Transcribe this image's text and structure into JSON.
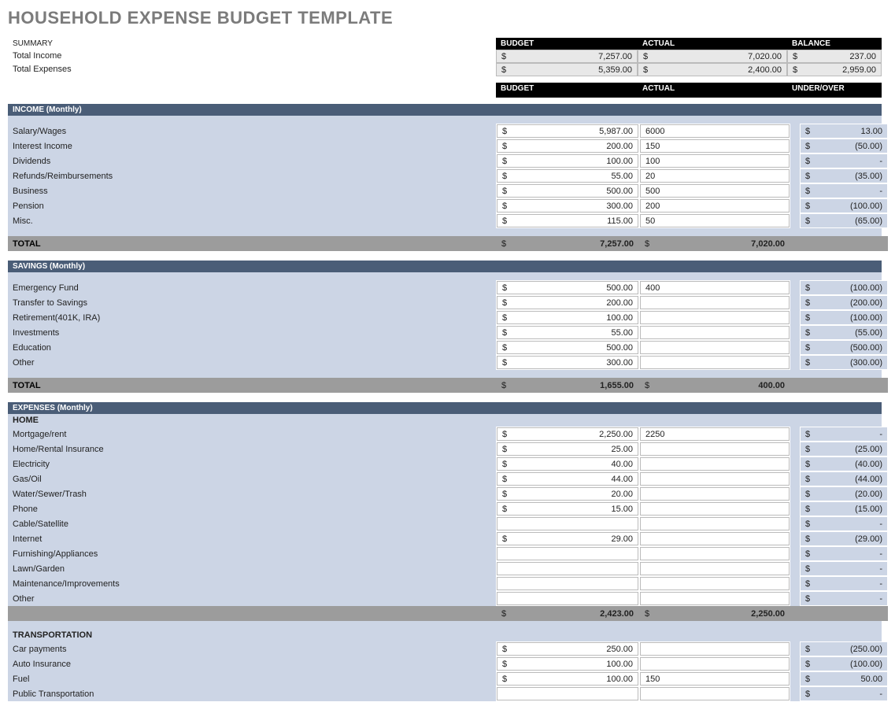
{
  "title": "HOUSEHOLD EXPENSE BUDGET TEMPLATE",
  "summary": {
    "label": "SUMMARY",
    "cols": {
      "budget": "BUDGET",
      "actual": "ACTUAL",
      "balance": "BALANCE"
    },
    "rows": [
      {
        "label": "Total Income",
        "budget": "7,257.00",
        "actual": "7,020.00",
        "balance": "237.00"
      },
      {
        "label": "Total Expenses",
        "budget": "5,359.00",
        "actual": "2,400.00",
        "balance": "2,959.00"
      }
    ]
  },
  "headers2": {
    "budget": "BUDGET",
    "actual": "ACTUAL",
    "uo": "UNDER/OVER"
  },
  "income": {
    "title": "INCOME (Monthly)",
    "rows": [
      {
        "label": "Salary/Wages",
        "budget": "5,987.00",
        "actual": "6000",
        "uo": "13.00"
      },
      {
        "label": "Interest Income",
        "budget": "200.00",
        "actual": "150",
        "uo": "(50.00)"
      },
      {
        "label": "Dividends",
        "budget": "100.00",
        "actual": "100",
        "uo": "-"
      },
      {
        "label": "Refunds/Reimbursements",
        "budget": "55.00",
        "actual": "20",
        "uo": "(35.00)"
      },
      {
        "label": "Business",
        "budget": "500.00",
        "actual": "500",
        "uo": "-"
      },
      {
        "label": "Pension",
        "budget": "300.00",
        "actual": "200",
        "uo": "(100.00)"
      },
      {
        "label": "Misc.",
        "budget": "115.00",
        "actual": "50",
        "uo": "(65.00)"
      }
    ],
    "total": {
      "label": "TOTAL",
      "budget": "7,257.00",
      "actual": "7,020.00"
    }
  },
  "savings": {
    "title": "SAVINGS (Monthly)",
    "rows": [
      {
        "label": "Emergency Fund",
        "budget": "500.00",
        "actual": "400",
        "uo": "(100.00)"
      },
      {
        "label": "Transfer to Savings",
        "budget": "200.00",
        "actual": "",
        "uo": "(200.00)"
      },
      {
        "label": "Retirement(401K, IRA)",
        "budget": "100.00",
        "actual": "",
        "uo": "(100.00)"
      },
      {
        "label": "Investments",
        "budget": "55.00",
        "actual": "",
        "uo": "(55.00)"
      },
      {
        "label": "Education",
        "budget": "500.00",
        "actual": "",
        "uo": "(500.00)"
      },
      {
        "label": "Other",
        "budget": "300.00",
        "actual": "",
        "uo": "(300.00)"
      }
    ],
    "total": {
      "label": "TOTAL",
      "budget": "1,655.00",
      "actual": "400.00"
    }
  },
  "expenses": {
    "title": "EXPENSES (Monthly)",
    "home": {
      "title": "HOME",
      "rows": [
        {
          "label": "Mortgage/rent",
          "budget": "2,250.00",
          "actual": "2250",
          "uo": "-"
        },
        {
          "label": "Home/Rental Insurance",
          "budget": "25.00",
          "actual": "",
          "uo": "(25.00)"
        },
        {
          "label": "Electricity",
          "budget": "40.00",
          "actual": "",
          "uo": "(40.00)"
        },
        {
          "label": "Gas/Oil",
          "budget": "44.00",
          "actual": "",
          "uo": "(44.00)"
        },
        {
          "label": "Water/Sewer/Trash",
          "budget": "20.00",
          "actual": "",
          "uo": "(20.00)"
        },
        {
          "label": "Phone",
          "budget": "15.00",
          "actual": "",
          "uo": "(15.00)"
        },
        {
          "label": "Cable/Satellite",
          "budget": "",
          "actual": "",
          "uo": "-"
        },
        {
          "label": "Internet",
          "budget": "29.00",
          "actual": "",
          "uo": "(29.00)"
        },
        {
          "label": "Furnishing/Appliances",
          "budget": "",
          "actual": "",
          "uo": "-"
        },
        {
          "label": "Lawn/Garden",
          "budget": "",
          "actual": "",
          "uo": "-"
        },
        {
          "label": "Maintenance/Improvements",
          "budget": "",
          "actual": "",
          "uo": "-"
        },
        {
          "label": "Other",
          "budget": "",
          "actual": "",
          "uo": "-"
        }
      ],
      "subtotal": {
        "budget": "2,423.00",
        "actual": "2,250.00"
      }
    },
    "transport": {
      "title": "TRANSPORTATION",
      "rows": [
        {
          "label": "Car payments",
          "budget": "250.00",
          "actual": "",
          "uo": "(250.00)"
        },
        {
          "label": "Auto Insurance",
          "budget": "100.00",
          "actual": "",
          "uo": "(100.00)"
        },
        {
          "label": "Fuel",
          "budget": "100.00",
          "actual": "150",
          "uo": "50.00"
        },
        {
          "label": "Public Transportation",
          "budget": "",
          "actual": "",
          "uo": "-"
        }
      ]
    }
  },
  "dollar": "$"
}
